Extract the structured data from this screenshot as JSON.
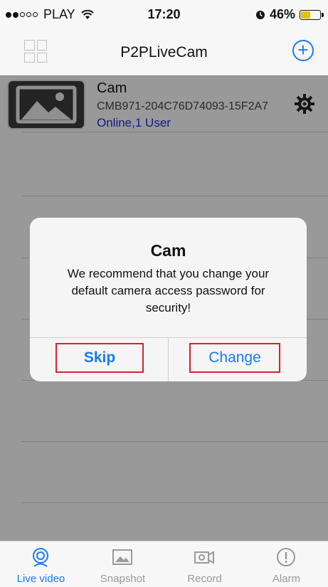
{
  "status_bar": {
    "carrier": "PLAY",
    "time": "17:20",
    "battery": "46%",
    "battery_level": 0.46,
    "icons": [
      "signal-dots",
      "wifi-icon",
      "alarm-icon",
      "battery-icon"
    ]
  },
  "navbar": {
    "title": "P2PLiveCam",
    "left_icon": "grid-icon",
    "right_icon": "add-circle-icon"
  },
  "camera": {
    "name": "Cam",
    "id": "CMB971-204C76D74093-15F2A7",
    "status": "Online,1 User",
    "settings_icon": "gear-icon"
  },
  "dialog": {
    "title": "Cam",
    "message": "We recommend that you change your default camera access password for security!",
    "buttons": {
      "skip": "Skip",
      "change": "Change"
    }
  },
  "tabs": [
    {
      "label": "Live video",
      "icon": "camera-lens-icon",
      "active": true
    },
    {
      "label": "Snapshot",
      "icon": "image-icon",
      "active": false
    },
    {
      "label": "Record",
      "icon": "video-record-icon",
      "active": false
    },
    {
      "label": "Alarm",
      "icon": "alert-icon",
      "active": false
    }
  ],
  "colors": {
    "accent": "#1a7af0",
    "status_online": "#1f2fd6",
    "highlight_border": "#d9202f"
  }
}
